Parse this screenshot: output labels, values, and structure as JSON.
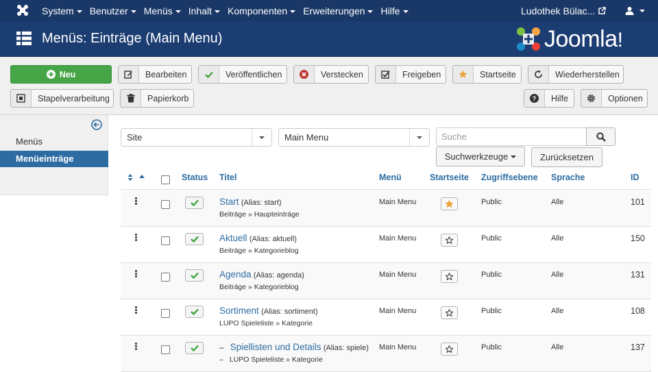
{
  "nav": {
    "items": [
      "System",
      "Benutzer",
      "Menüs",
      "Inhalt",
      "Komponenten",
      "Erweiterungen",
      "Hilfe"
    ],
    "site_name": "Ludothek Bülac..."
  },
  "header": {
    "title": "Menüs: Einträge (Main Menu)",
    "brand": "Joomla!"
  },
  "toolbar": {
    "new": "Neu",
    "edit": "Bearbeiten",
    "publish": "Veröffentlichen",
    "unpublish": "Verstecken",
    "checkin": "Freigeben",
    "home": "Startseite",
    "rebuild": "Wiederherstellen",
    "batch": "Stapelverarbeitung",
    "trash": "Papierkorb",
    "help": "Hilfe",
    "options": "Optionen"
  },
  "sidebar": {
    "items": [
      {
        "label": "Menüs",
        "active": false
      },
      {
        "label": "Menüeinträge",
        "active": true
      }
    ]
  },
  "filters": {
    "client": "Site",
    "menu": "Main Menu",
    "search_placeholder": "Suche",
    "search_tools": "Suchwerkzeuge",
    "reset": "Zurücksetzen"
  },
  "table": {
    "headers": {
      "status": "Status",
      "title": "Titel",
      "menu": "Menü",
      "home": "Startseite",
      "access": "Zugriffsebene",
      "language": "Sprache",
      "id": "ID"
    },
    "rows": [
      {
        "prefix": "",
        "title": "Start",
        "alias": "(Alias: start)",
        "type": "Beiträge » Haupteinträge",
        "menu": "Main Menu",
        "home": true,
        "access": "Public",
        "language": "Alle",
        "id": "101"
      },
      {
        "prefix": "",
        "title": "Aktuell",
        "alias": "(Alias: aktuell)",
        "type": "Beiträge » Kategorieblog",
        "menu": "Main Menu",
        "home": false,
        "access": "Public",
        "language": "Alle",
        "id": "150"
      },
      {
        "prefix": "",
        "title": "Agenda",
        "alias": "(Alias: agenda)",
        "type": "Beiträge » Kategorieblog",
        "menu": "Main Menu",
        "home": false,
        "access": "Public",
        "language": "Alle",
        "id": "131"
      },
      {
        "prefix": "",
        "title": "Sortiment",
        "alias": "(Alias: sortiment)",
        "type": "LUPO Spieleliste » Kategorie",
        "menu": "Main Menu",
        "home": false,
        "access": "Public",
        "language": "Alle",
        "id": "108"
      },
      {
        "prefix": "–",
        "title": "Spiellisten und Details",
        "alias": "(Alias: spiele)",
        "type": "LUPO Spieleliste » Kategorie",
        "menu": "Main Menu",
        "home": false,
        "access": "Public",
        "language": "Alle",
        "id": "137"
      }
    ]
  },
  "colors": {
    "navbar": "#1a3867",
    "header": "#1c3d72",
    "success": "#46a546",
    "link": "#2d6ca2",
    "check": "#46a546",
    "star_active": "#e8a33d"
  }
}
